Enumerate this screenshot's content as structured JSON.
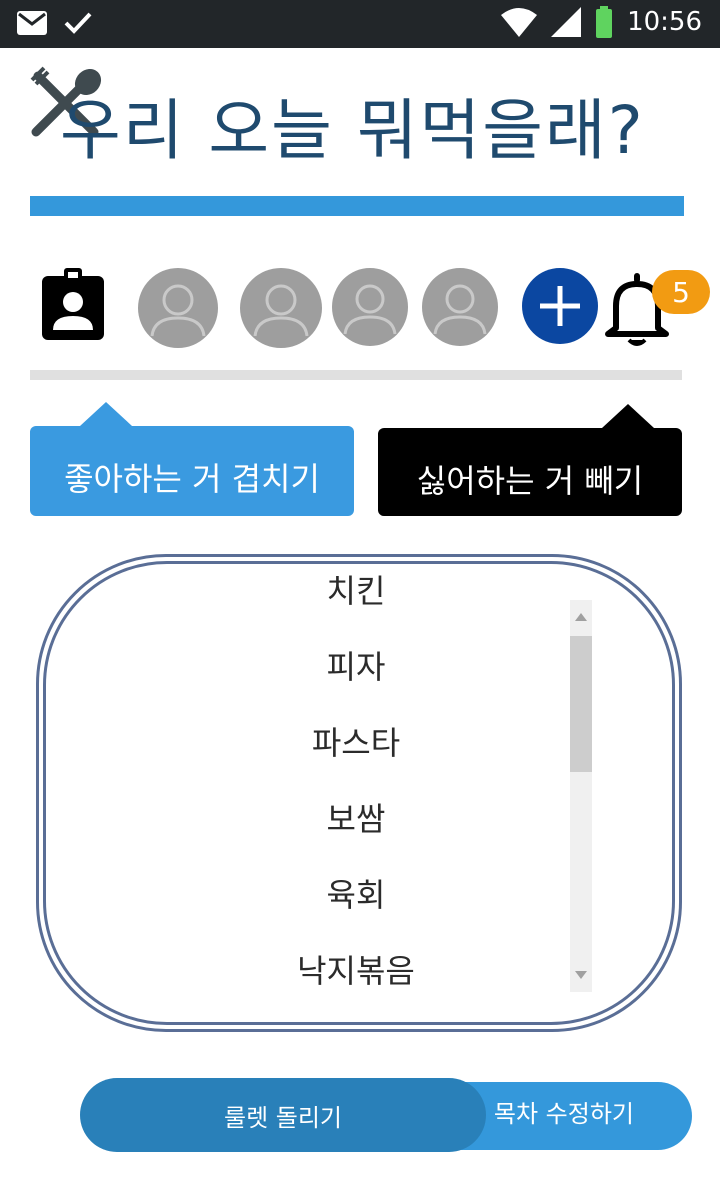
{
  "status_bar": {
    "time": "10:56",
    "icons": [
      "mail-icon",
      "check-icon",
      "wifi-icon",
      "signal-icon",
      "battery-icon"
    ]
  },
  "header": {
    "title": "우리 오늘 뭐먹을래?",
    "logo_icon": "spoon-fork-icon"
  },
  "members": {
    "contact_icon": "contact-card-icon",
    "avatars": [
      "avatar",
      "avatar",
      "avatar",
      "avatar"
    ],
    "add_icon": "plus-icon",
    "notification_icon": "bell-icon",
    "notification_count": "5"
  },
  "actions": {
    "like_label": "좋아하는 거 겹치기",
    "dislike_label": "싫어하는 거 빼기"
  },
  "menu": {
    "items": [
      "치킨",
      "피자",
      "파스타",
      "보쌈",
      "육회",
      "낙지볶음"
    ]
  },
  "bottom": {
    "roulette_label": "룰렛 돌리기",
    "edit_label": "목차 수정하기"
  },
  "colors": {
    "title": "#1f4a6e",
    "accent": "#3498db",
    "add_button": "#0b47a1",
    "badge": "#f29b12",
    "frame": "#5a6e96"
  }
}
